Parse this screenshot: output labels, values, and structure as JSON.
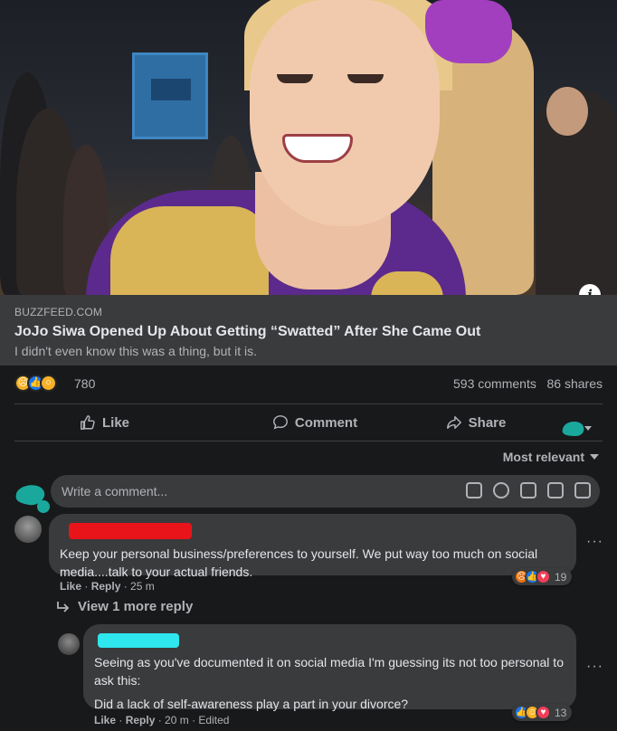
{
  "link_preview": {
    "source": "BUZZFEED.COM",
    "title": "JoJo Siwa Opened Up About Getting “Swatted” After She Came Out",
    "subtitle": "I didn't even know this was a thing, but it is."
  },
  "reactions": {
    "icons": [
      "sad-reaction",
      "like-reaction",
      "wow-reaction"
    ],
    "count": "780",
    "comments": "593 comments",
    "shares": "86 shares"
  },
  "actions": {
    "like": "Like",
    "comment": "Comment",
    "share": "Share"
  },
  "sort": {
    "label": "Most relevant"
  },
  "composer": {
    "placeholder": "Write a comment..."
  },
  "comments": [
    {
      "text": "Keep your personal business/preferences to yourself. We put way too much on social media....talk to your actual friends.",
      "like": "Like",
      "reply": "Reply",
      "time": "25 m",
      "reaction_count": "19",
      "view_replies": "View 1 more reply"
    },
    {
      "text_1": "Seeing as you've documented it on social media I'm guessing its not too personal to ask this:",
      "text_2": "Did a lack of self-awareness play a part in your divorce?",
      "like": "Like",
      "reply": "Reply",
      "time": "20 m",
      "edited": "Edited",
      "reaction_count": "13"
    }
  ],
  "colors": {
    "background": "#18191a",
    "surface": "#3a3b3c",
    "text_primary": "#e4e6eb",
    "text_secondary": "#b0b3b8",
    "redaction_red": "#e8141a",
    "redaction_cyan": "#2ee6ee",
    "scribble_teal": "#1aa89d"
  }
}
